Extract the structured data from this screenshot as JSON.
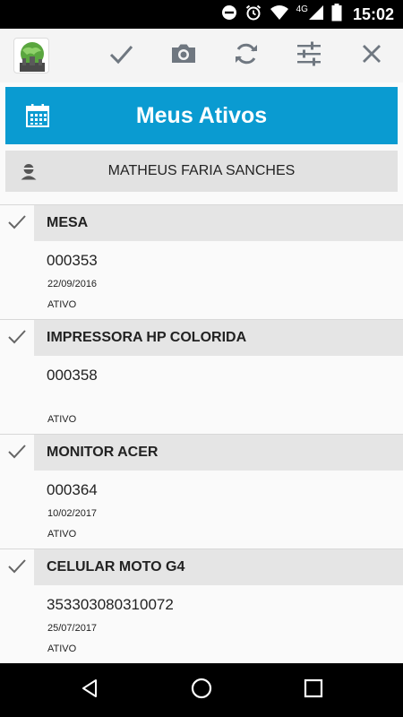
{
  "status_bar": {
    "network": "4G",
    "time": "15:02"
  },
  "header": {
    "title": "Meus Ativos"
  },
  "user": {
    "name": "MATHEUS FARIA SANCHES"
  },
  "assets": [
    {
      "name": "MESA",
      "code": "000353",
      "date": "22/09/2016",
      "status": "ATIVO"
    },
    {
      "name": "IMPRESSORA HP COLORIDA",
      "code": "000358",
      "date": "",
      "status": "ATIVO"
    },
    {
      "name": "MONITOR ACER",
      "code": "000364",
      "date": "10/02/2017",
      "status": "ATIVO"
    },
    {
      "name": "CELULAR MOTO G4",
      "code": "353303080310072",
      "date": "25/07/2017",
      "status": "ATIVO"
    }
  ],
  "colors": {
    "accent": "#0a9bd1",
    "toolbar_icon": "#6f7780"
  }
}
